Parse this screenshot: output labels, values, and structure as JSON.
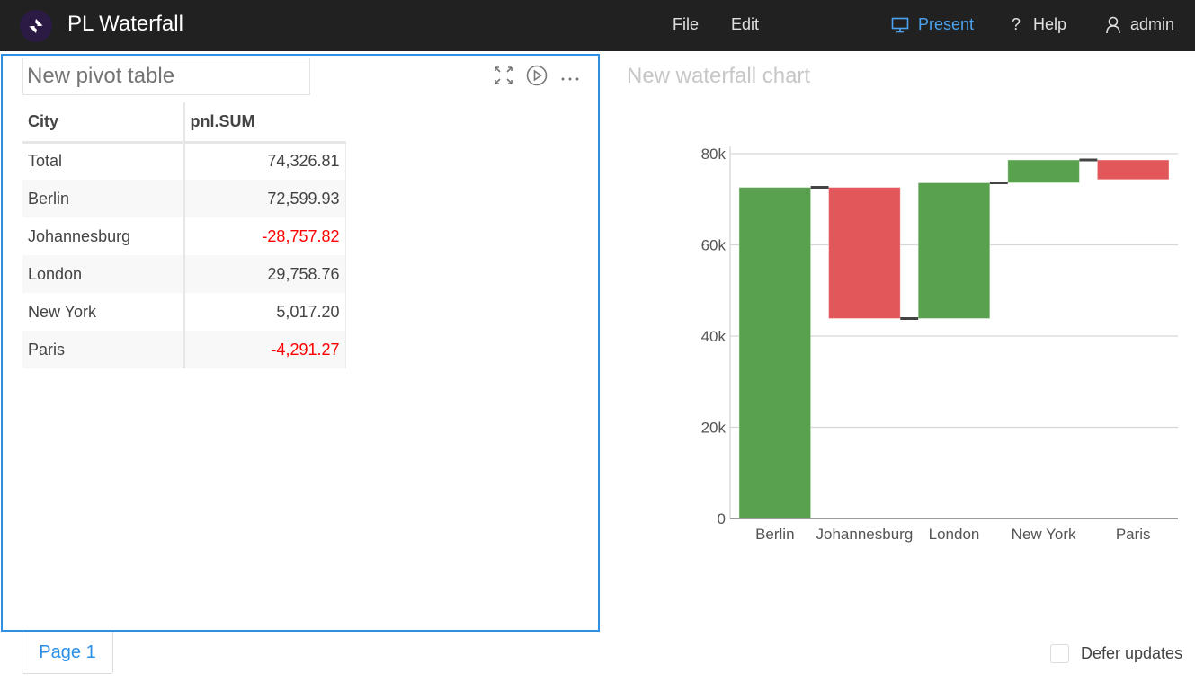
{
  "header": {
    "logo_icon": "dash-logo-icon",
    "title": "PL Waterfall",
    "menu": [
      "File",
      "Edit"
    ],
    "present_label": "Present",
    "help_label": "Help",
    "user_label": "admin",
    "accent_color": "#4aa3f0"
  },
  "pivot_panel": {
    "title_placeholder": "New pivot table",
    "icons": [
      "expand-icon",
      "play-icon",
      "more-icon"
    ],
    "columns": [
      "City",
      "pnl.SUM"
    ],
    "rows": [
      {
        "city": "Total",
        "value": "74,326.81",
        "negative": false
      },
      {
        "city": "Berlin",
        "value": "72,599.93",
        "negative": false
      },
      {
        "city": "Johannesburg",
        "value": "-28,757.82",
        "negative": true
      },
      {
        "city": "London",
        "value": "29,758.76",
        "negative": false
      },
      {
        "city": "New York",
        "value": "5,017.20",
        "negative": false
      },
      {
        "city": "Paris",
        "value": "-4,291.27",
        "negative": true
      }
    ],
    "negative_color": "#ff0000"
  },
  "chart_panel": {
    "title_placeholder": "New waterfall chart"
  },
  "chart_data": {
    "type": "waterfall",
    "title": "New waterfall chart",
    "categories": [
      "Berlin",
      "Johannesburg",
      "London",
      "New York",
      "Paris"
    ],
    "values": [
      72599.93,
      -28757.82,
      29758.76,
      5017.2,
      -4291.27
    ],
    "xlabel": "",
    "ylabel": "",
    "ylim": [
      0,
      80000
    ],
    "yticks": [
      0,
      20000,
      40000,
      60000,
      80000
    ],
    "ytick_labels": [
      "0",
      "20k",
      "40k",
      "60k",
      "80k"
    ],
    "grid": true,
    "increase_color": "#5aa14f",
    "decrease_color": "#e1575a",
    "connector_color": "#444444"
  },
  "footer": {
    "page_tab": "Page 1",
    "defer_label": "Defer updates",
    "defer_checked": false
  }
}
